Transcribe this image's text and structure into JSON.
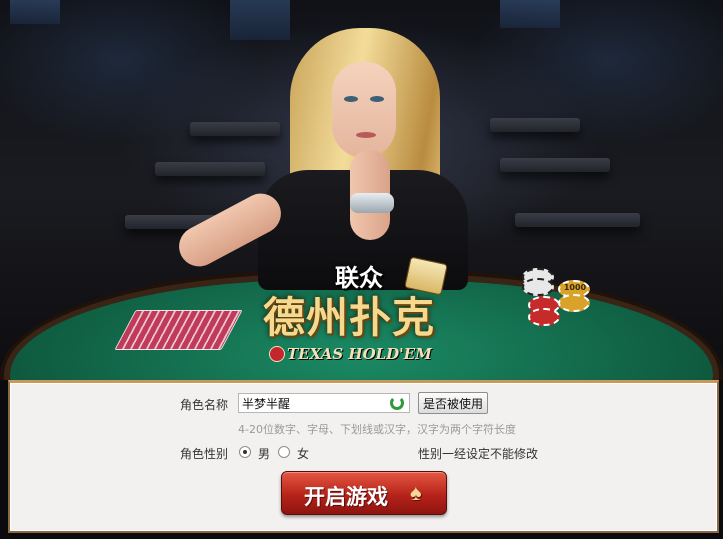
{
  "logo": {
    "brand": "联众",
    "title": "德州扑克",
    "subtitle": "TEXAS HOLD'EM"
  },
  "chips": {
    "value": "1000"
  },
  "form": {
    "name_label": "角色名称",
    "name_value": "半梦半醒",
    "check_button": "是否被使用",
    "hint": "4-20位数字、字母、下划线或汉字，汉字为两个字符长度",
    "gender_label": "角色性别",
    "gender_male": "男",
    "gender_female": "女",
    "gender_selected": "男",
    "gender_note": "性别一经设定不能修改"
  },
  "start_button": {
    "label": "开启游戏",
    "icon": "spade-icon"
  }
}
